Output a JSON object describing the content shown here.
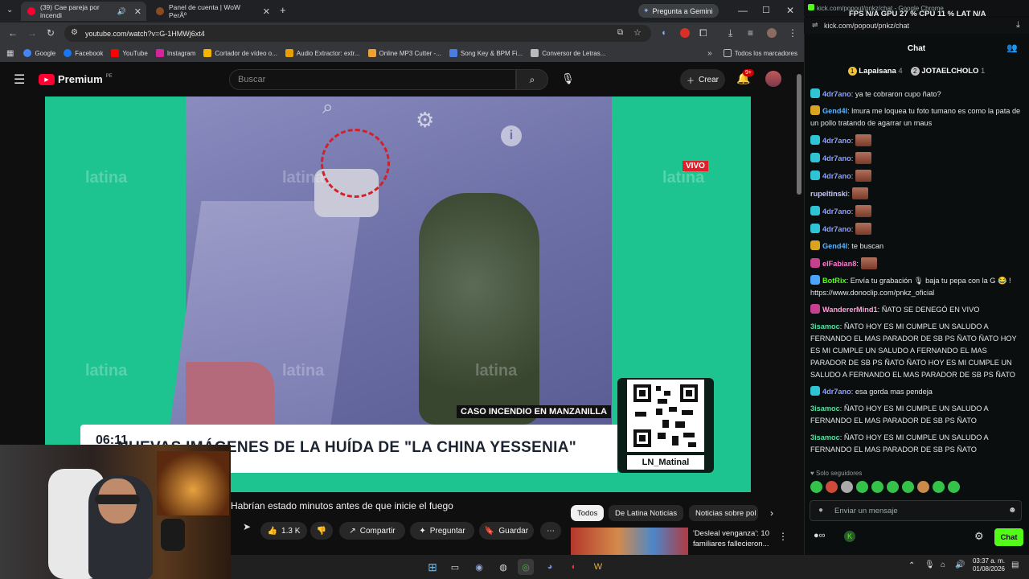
{
  "browser": {
    "tabs": [
      {
        "title": "(39) Cae pareja por incendi"
      },
      {
        "title": "Panel de cuenta | WoW PerÃº"
      }
    ],
    "gemini_label": "Pregunta a Gemini",
    "url": "youtube.com/watch?v=G-1HMWj6xt4",
    "bookmarks": [
      "Google",
      "Facebook",
      "YouTube",
      "Instagram",
      "Cortador de vídeo o...",
      "Audio Extractor: extr...",
      "Online MP3 Cutter -...",
      "Song Key & BPM Fi...",
      "Conversor de Letras..."
    ],
    "all_bookmarks": "Todos los marcadores"
  },
  "youtube": {
    "logo": "Premium",
    "logo_region": "PE",
    "search_placeholder": "Buscar",
    "create_label": "Crear",
    "notif_count": "9+",
    "video_overlay": {
      "live_badge": "VIVO",
      "case_label": "CASO INCENDIO EN MANZANILLA",
      "time": "06:11",
      "headline": "NUEVAS IMÁGENES DE LA HUÍDA DE \"LA CHINA YESSENIA\"",
      "qr_handle": "LN_Matinal",
      "watermark": "latina"
    },
    "video_title": "Habrían estado minutos antes de que inicie el fuego",
    "like_count": "1.3 K",
    "share_label": "Compartir",
    "ask_label": "Preguntar",
    "save_label": "Guardar",
    "chips": [
      "Todos",
      "De Latina Noticias",
      "Noticias sobre pol"
    ],
    "suggestion_title": "'Desleal venganza': 10 familiares fallecieron..."
  },
  "kick": {
    "window_title": "kick.com/popout/pnkz/chat - Google Chrome",
    "stats": "FPS N/A   GPU 27 %   CPU 11 %   LAT N/A",
    "url": "kick.com/popout/pnkz/chat",
    "chat_header": "Chat",
    "pinned": [
      {
        "rank": "1",
        "name": "Lapaisana",
        "count": "4"
      },
      {
        "rank": "2",
        "name": "JOTAELCHOLO",
        "count": "1"
      }
    ],
    "messages": [
      {
        "user": "4dr7ano",
        "color": "#8ea0ff",
        "text": "ya te cobraron cupo ñato?",
        "badge": "#2ec4d6"
      },
      {
        "user": "Gend4l",
        "color": "#5ab4ff",
        "text": "lmura me loquea tu foto tumano es como la pata de un pollo tratando de agarrar un maus",
        "badge": "#d9a521"
      },
      {
        "user": "4dr7ano",
        "color": "#8ea0ff",
        "text": "",
        "badge": "#2ec4d6",
        "emote": true
      },
      {
        "user": "4dr7ano",
        "color": "#8ea0ff",
        "text": "",
        "badge": "#2ec4d6",
        "emote": true
      },
      {
        "user": "4dr7ano",
        "color": "#8ea0ff",
        "text": "",
        "badge": "#2ec4d6",
        "emote": true
      },
      {
        "user": "rupeltinski",
        "color": "#c5c5ff",
        "text": "",
        "badge": "",
        "emote": true
      },
      {
        "user": "4dr7ano",
        "color": "#8ea0ff",
        "text": "",
        "badge": "#2ec4d6",
        "emote": true
      },
      {
        "user": "4dr7ano",
        "color": "#8ea0ff",
        "text": "",
        "badge": "#2ec4d6",
        "emote": true
      },
      {
        "user": "Gend4l",
        "color": "#5ab4ff",
        "text": "te buscan",
        "badge": "#d9a521"
      },
      {
        "user": "elFabian8",
        "color": "#ff7ad0",
        "text": "",
        "badge": "#c73f8f",
        "emote": true
      },
      {
        "user": "BotRix",
        "color": "#53fc18",
        "text": "Envía tu grabación 🎙 baja tu pepa con la G 😂 ! https://www.donoclip.com/pnkz_oficial",
        "badge": "#4aa3ff"
      },
      {
        "user": "WandererMind1",
        "color": "#ff9fd8",
        "text": "ÑATO SE DENEGÓ EN VIVO",
        "badge": "#c73f8f"
      },
      {
        "user": "3isamoc",
        "color": "#53e0a0",
        "text": "ÑATO HOY ES MI CUMPLE UN SALUDO A FERNANDO EL MAS PARADOR DE SB PS ÑATO ÑATO HOY ES MI CUMPLE UN SALUDO A FERNANDO EL MAS PARADOR DE SB PS ÑATO ÑATO HOY ES MI CUMPLE UN SALUDO A FERNANDO EL MAS PARADOR DE SB PS ÑATO",
        "badge": ""
      },
      {
        "user": "4dr7ano",
        "color": "#8ea0ff",
        "text": "esa gorda mas pendeja",
        "badge": "#2ec4d6"
      },
      {
        "user": "3isamoc",
        "color": "#53e0a0",
        "text": "ÑATO HOY ES MI CUMPLE UN SALUDO A FERNANDO EL MAS PARADOR DE SB PS ÑATO",
        "badge": ""
      },
      {
        "user": "3isamoc",
        "color": "#53e0a0",
        "text": "ÑATO HOY ES MI CUMPLE UN SALUDO A FERNANDO EL MAS PARADOR DE SB PS ÑATO",
        "badge": ""
      }
    ],
    "followers_only": "Solo seguidores",
    "input_placeholder": "Enviar un mensaje",
    "send_label": "Chat"
  },
  "taskbar": {
    "time": "03:37 a. m.",
    "date": "01/08/2026"
  }
}
